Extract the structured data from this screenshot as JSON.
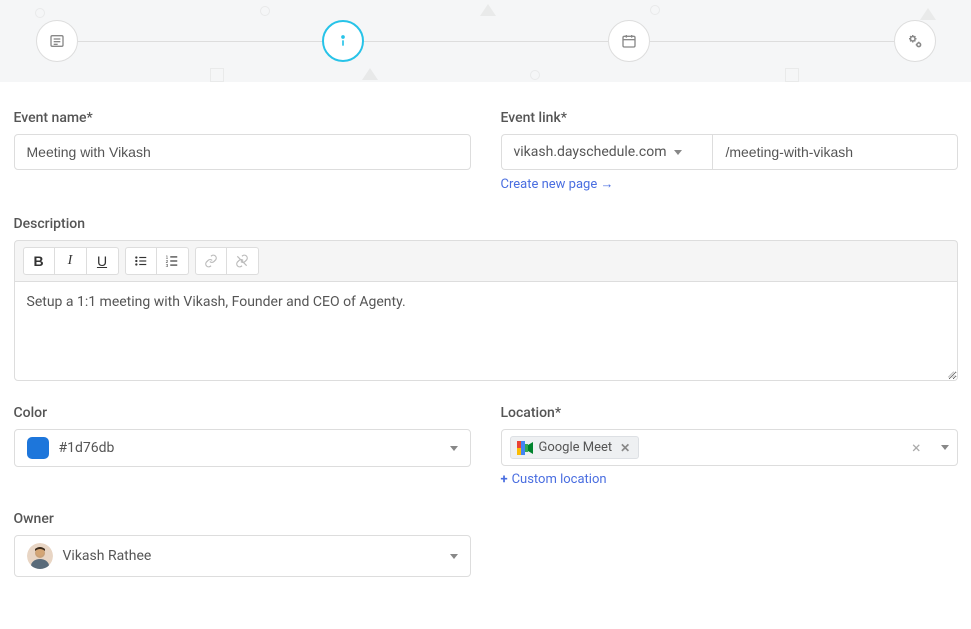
{
  "stepper": {
    "steps": [
      "list",
      "info",
      "calendar",
      "settings"
    ]
  },
  "eventName": {
    "label": "Event name*",
    "value": "Meeting with Vikash"
  },
  "eventLink": {
    "label": "Event link*",
    "domain": "vikash.dayschedule.com",
    "slug": "/meeting-with-vikash",
    "createPageLabel": "Create new page →"
  },
  "description": {
    "label": "Description",
    "value": "Setup a 1:1 meeting with Vikash, Founder and CEO of Agenty."
  },
  "color": {
    "label": "Color",
    "hex": "#1d76db"
  },
  "location": {
    "label": "Location*",
    "chipText": "Google Meet",
    "customLabel": "Custom location"
  },
  "owner": {
    "label": "Owner",
    "name": "Vikash Rathee"
  }
}
